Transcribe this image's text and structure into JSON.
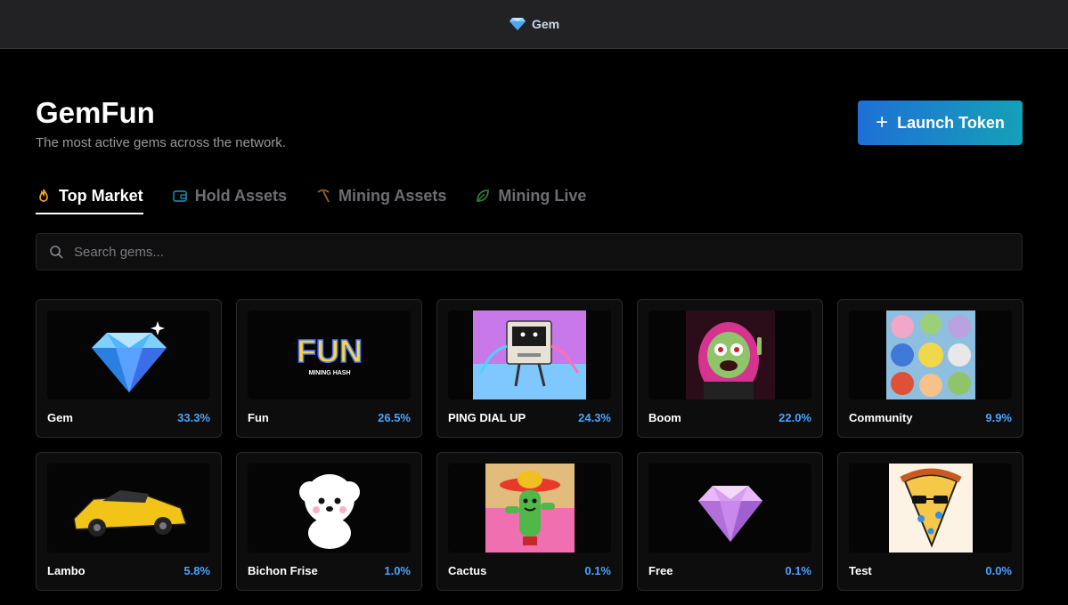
{
  "topbar": {
    "brand": "Gem",
    "icon": "diamond-icon"
  },
  "header": {
    "title": "GemFun",
    "subtitle": "The most active gems across the network.",
    "launch_label": "Launch Token"
  },
  "tabs": [
    {
      "label": "Top Market",
      "icon": "flame-icon",
      "active": true
    },
    {
      "label": "Hold Assets",
      "icon": "wallet-icon",
      "active": false
    },
    {
      "label": "Mining Assets",
      "icon": "pickaxe-icon",
      "active": false
    },
    {
      "label": "Mining Live",
      "icon": "leaf-icon",
      "active": false
    }
  ],
  "search": {
    "placeholder": "Search gems...",
    "value": ""
  },
  "gems": [
    {
      "name": "Gem",
      "percent": "33.3%"
    },
    {
      "name": "Fun",
      "percent": "26.5%",
      "image_text": "FUN",
      "image_subtext": "MINING HASH"
    },
    {
      "name": "PING DIAL UP",
      "percent": "24.3%"
    },
    {
      "name": "Boom",
      "percent": "22.0%"
    },
    {
      "name": "Community",
      "percent": "9.9%"
    },
    {
      "name": "Lambo",
      "percent": "5.8%"
    },
    {
      "name": "Bichon Frise",
      "percent": "1.0%"
    },
    {
      "name": "Cactus",
      "percent": "0.1%"
    },
    {
      "name": "Free",
      "percent": "0.1%"
    },
    {
      "name": "Test",
      "percent": "0.0%"
    }
  ],
  "colors": {
    "accent": "#4aa3ff",
    "launch_from": "#1f6fd6",
    "launch_to": "#15a0b8"
  }
}
